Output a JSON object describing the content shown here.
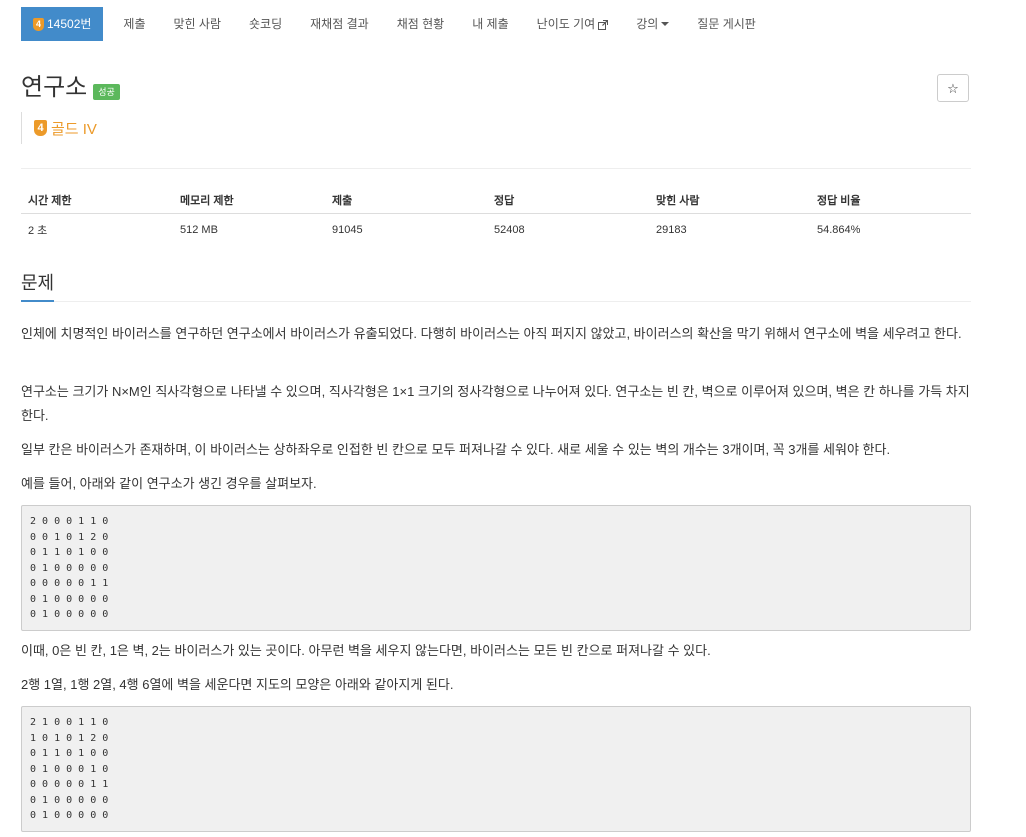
{
  "nav": {
    "problem_badge": "14502번",
    "tier_digit": "4",
    "items": [
      "제출",
      "맞힌 사람",
      "숏코딩",
      "재채점 결과",
      "채점 현황",
      "내 제출",
      "난이도 기여",
      "강의",
      "질문 게시판"
    ]
  },
  "problem": {
    "title": "연구소",
    "status_badge": "성공",
    "star_label": "☆",
    "tier_digit": "4",
    "tier_label": "골드 IV"
  },
  "stats": {
    "headers": [
      "시간 제한",
      "메모리 제한",
      "제출",
      "정답",
      "맞힌 사람",
      "정답 비율"
    ],
    "values": [
      "2 초",
      "512 MB",
      "91045",
      "52408",
      "29183",
      "54.864%"
    ]
  },
  "section": {
    "heading": "문제"
  },
  "description": {
    "p1": "인체에 치명적인 바이러스를 연구하던 연구소에서 바이러스가 유출되었다. 다행히 바이러스는 아직 퍼지지 않았고, 바이러스의 확산을 막기 위해서 연구소에 벽을 세우려고 한다.",
    "p2": "연구소는 크기가 N×M인 직사각형으로 나타낼 수 있으며, 직사각형은 1×1 크기의 정사각형으로 나누어져 있다. 연구소는 빈 칸, 벽으로 이루어져 있으며, 벽은 칸 하나를 가득 차지한다.",
    "p3": "일부 칸은 바이러스가 존재하며, 이 바이러스는 상하좌우로 인접한 빈 칸으로 모두 퍼져나갈 수 있다. 새로 세울 수 있는 벽의 개수는 3개이며, 꼭 3개를 세워야 한다.",
    "p4": "예를 들어, 아래와 같이 연구소가 생긴 경우를 살펴보자.",
    "grid1": "2 0 0 0 1 1 0\n0 0 1 0 1 2 0\n0 1 1 0 1 0 0\n0 1 0 0 0 0 0\n0 0 0 0 0 1 1\n0 1 0 0 0 0 0\n0 1 0 0 0 0 0",
    "p5": "이때, 0은 빈 칸, 1은 벽, 2는 바이러스가 있는 곳이다. 아무런 벽을 세우지 않는다면, 바이러스는 모든 빈 칸으로 퍼져나갈 수 있다.",
    "p6": "2행 1열, 1행 2열, 4행 6열에 벽을 세운다면 지도의 모양은 아래와 같아지게 된다.",
    "grid2": "2 1 0 0 1 1 0\n1 0 1 0 1 2 0\n0 1 1 0 1 0 0\n0 1 0 0 0 1 0\n0 0 0 0 0 1 1\n0 1 0 0 0 0 0\n0 1 0 0 0 0 0"
  },
  "colors": {
    "accent": "#428bca",
    "success": "#5cb85c",
    "gold": "#ec9a29"
  }
}
